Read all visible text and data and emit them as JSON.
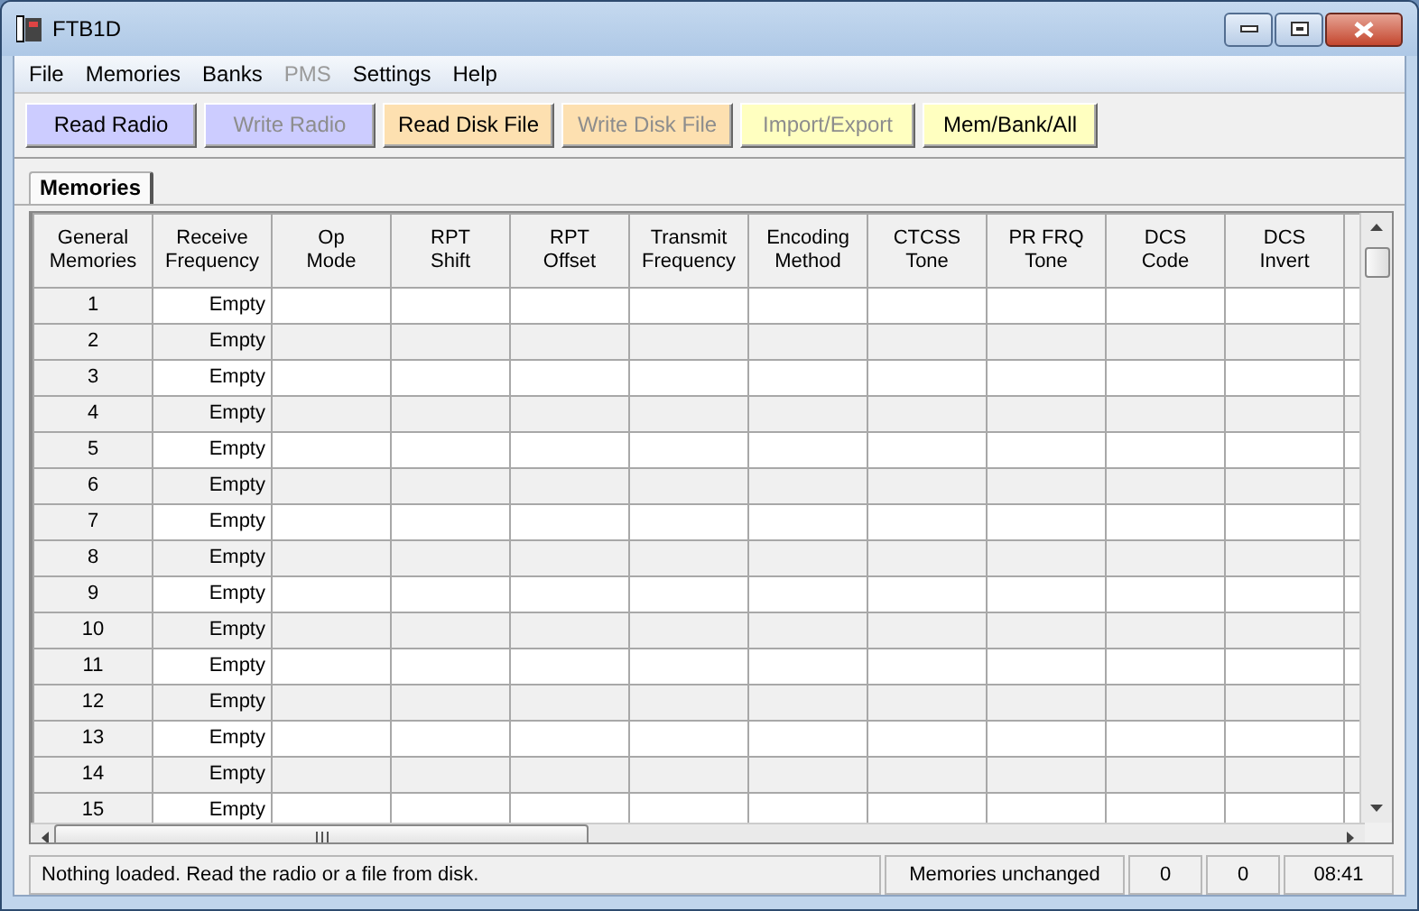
{
  "window": {
    "title": "FTB1D"
  },
  "menu": [
    {
      "label": "File",
      "disabled": false
    },
    {
      "label": "Memories",
      "disabled": false
    },
    {
      "label": "Banks",
      "disabled": false
    },
    {
      "label": "PMS",
      "disabled": true
    },
    {
      "label": "Settings",
      "disabled": false
    },
    {
      "label": "Help",
      "disabled": false
    }
  ],
  "toolbar": [
    {
      "label": "Read Radio",
      "color": "#ccccff",
      "disabled": false
    },
    {
      "label": "Write Radio",
      "color": "#ccccff",
      "disabled": true
    },
    {
      "label": "Read Disk File",
      "color": "#fde0b0",
      "disabled": false
    },
    {
      "label": "Write Disk File",
      "color": "#fde0b0",
      "disabled": true
    },
    {
      "label": "Import/Export",
      "color": "#ffffc0",
      "disabled": true
    },
    {
      "label": "Mem/Bank/All",
      "color": "#ffffc0",
      "disabled": false
    }
  ],
  "tabs": [
    {
      "label": "Memories",
      "selected": true
    }
  ],
  "table": {
    "columns": [
      "General\nMemories",
      "Receive\nFrequency",
      "Op\nMode",
      "RPT\nShift",
      "RPT\nOffset",
      "Transmit\nFrequency",
      "Encoding\nMethod",
      "CTCSS\nTone",
      "PR FRQ\nTone",
      "DCS\nCode",
      "DCS\nInvert"
    ],
    "rows": [
      {
        "number": "1",
        "receive_frequency": "Empty"
      },
      {
        "number": "2",
        "receive_frequency": "Empty"
      },
      {
        "number": "3",
        "receive_frequency": "Empty"
      },
      {
        "number": "4",
        "receive_frequency": "Empty"
      },
      {
        "number": "5",
        "receive_frequency": "Empty"
      },
      {
        "number": "6",
        "receive_frequency": "Empty"
      },
      {
        "number": "7",
        "receive_frequency": "Empty"
      },
      {
        "number": "8",
        "receive_frequency": "Empty"
      },
      {
        "number": "9",
        "receive_frequency": "Empty"
      },
      {
        "number": "10",
        "receive_frequency": "Empty"
      },
      {
        "number": "11",
        "receive_frequency": "Empty"
      },
      {
        "number": "12",
        "receive_frequency": "Empty"
      },
      {
        "number": "13",
        "receive_frequency": "Empty"
      },
      {
        "number": "14",
        "receive_frequency": "Empty"
      },
      {
        "number": "15",
        "receive_frequency": "Empty"
      }
    ]
  },
  "status_bar": {
    "message": "Nothing loaded. Read the radio or a file from disk.",
    "memories_state": "Memories unchanged",
    "count_1": "0",
    "count_2": "0",
    "time": "08:41"
  }
}
